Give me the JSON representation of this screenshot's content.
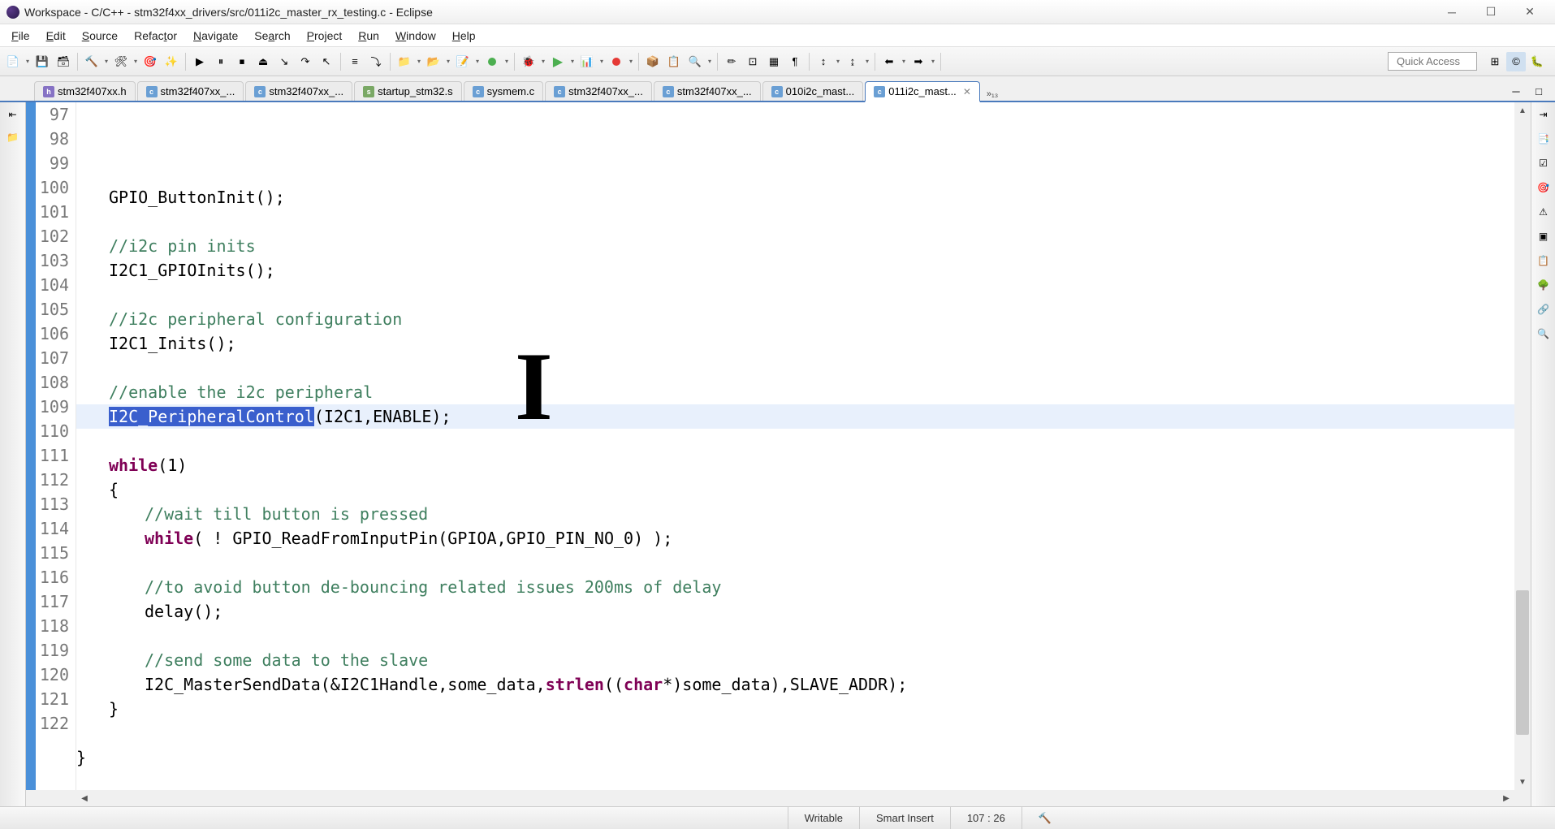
{
  "window": {
    "title": "Workspace - C/C++ - stm32f4xx_drivers/src/011i2c_master_rx_testing.c - Eclipse"
  },
  "menu": {
    "items": [
      "File",
      "Edit",
      "Source",
      "Refactor",
      "Navigate",
      "Search",
      "Project",
      "Run",
      "Window",
      "Help"
    ]
  },
  "toolbar": {
    "quick_access_placeholder": "Quick Access"
  },
  "tabs": {
    "items": [
      {
        "label": "stm32f407xx.h",
        "icon": "h"
      },
      {
        "label": "stm32f407xx_...",
        "icon": "c"
      },
      {
        "label": "stm32f407xx_...",
        "icon": "c"
      },
      {
        "label": "startup_stm32.s",
        "icon": "s"
      },
      {
        "label": "sysmem.c",
        "icon": "c"
      },
      {
        "label": "stm32f407xx_...",
        "icon": "c"
      },
      {
        "label": "stm32f407xx_...",
        "icon": "c"
      },
      {
        "label": "010i2c_mast...",
        "icon": "c"
      },
      {
        "label": "011i2c_mast...",
        "icon": "c",
        "active": true
      }
    ],
    "overflow": "»₁₃"
  },
  "editor": {
    "first_line": 97,
    "lines": [
      {
        "n": 97,
        "segs": [
          {
            "t": ""
          }
        ]
      },
      {
        "n": 98,
        "segs": [
          {
            "t": "GPIO_ButtonInit();"
          }
        ]
      },
      {
        "n": 99,
        "segs": [
          {
            "t": ""
          }
        ]
      },
      {
        "n": 100,
        "segs": [
          {
            "t": "//i2c pin inits",
            "c": "cm"
          }
        ]
      },
      {
        "n": 101,
        "segs": [
          {
            "t": "I2C1_GPIOInits();"
          }
        ]
      },
      {
        "n": 102,
        "segs": [
          {
            "t": ""
          }
        ]
      },
      {
        "n": 103,
        "segs": [
          {
            "t": "//i2c peripheral configuration",
            "c": "cm"
          }
        ]
      },
      {
        "n": 104,
        "segs": [
          {
            "t": "I2C1_Inits();"
          }
        ]
      },
      {
        "n": 105,
        "segs": [
          {
            "t": ""
          }
        ]
      },
      {
        "n": 106,
        "segs": [
          {
            "t": "//enable the i2c peripheral",
            "c": "cm"
          }
        ]
      },
      {
        "n": 107,
        "hl": true,
        "segs": [
          {
            "t": "I2C_PeripheralControl",
            "c": "sel"
          },
          {
            "t": "(I2C1,ENABLE);"
          }
        ]
      },
      {
        "n": 108,
        "segs": [
          {
            "t": ""
          }
        ]
      },
      {
        "n": 109,
        "segs": [
          {
            "t": "while",
            "c": "kw"
          },
          {
            "t": "(1)"
          }
        ]
      },
      {
        "n": 110,
        "segs": [
          {
            "t": "{"
          }
        ]
      },
      {
        "n": 111,
        "indent": 1,
        "segs": [
          {
            "t": "//wait till button is pressed",
            "c": "cm"
          }
        ]
      },
      {
        "n": 112,
        "indent": 1,
        "segs": [
          {
            "t": "while",
            "c": "kw"
          },
          {
            "t": "( ! GPIO_ReadFromInputPin(GPIOA,GPIO_PIN_NO_0) );"
          }
        ]
      },
      {
        "n": 113,
        "segs": [
          {
            "t": ""
          }
        ]
      },
      {
        "n": 114,
        "indent": 1,
        "segs": [
          {
            "t": "//to avoid button de-bouncing related issues 200ms of delay",
            "c": "cm"
          }
        ]
      },
      {
        "n": 115,
        "indent": 1,
        "segs": [
          {
            "t": "delay();"
          }
        ]
      },
      {
        "n": 116,
        "segs": [
          {
            "t": ""
          }
        ]
      },
      {
        "n": 117,
        "indent": 1,
        "segs": [
          {
            "t": "//send some data to the slave",
            "c": "cm"
          }
        ]
      },
      {
        "n": 118,
        "indent": 1,
        "segs": [
          {
            "t": "I2C_MasterSendData(&I2C1Handle,some_data,"
          },
          {
            "t": "strlen",
            "c": "kw"
          },
          {
            "t": "(("
          },
          {
            "t": "char",
            "c": "kw"
          },
          {
            "t": "*)some_data),SLAVE_ADDR);"
          }
        ]
      },
      {
        "n": 119,
        "segs": [
          {
            "t": "}"
          }
        ]
      },
      {
        "n": 120,
        "outdent": true,
        "segs": [
          {
            "t": ""
          }
        ]
      },
      {
        "n": 121,
        "outdent": true,
        "segs": [
          {
            "t": "}"
          }
        ]
      },
      {
        "n": 122,
        "outdent": true,
        "segs": [
          {
            "t": ""
          }
        ]
      }
    ]
  },
  "status": {
    "writable": "Writable",
    "insert_mode": "Smart Insert",
    "cursor": "107 : 26"
  }
}
